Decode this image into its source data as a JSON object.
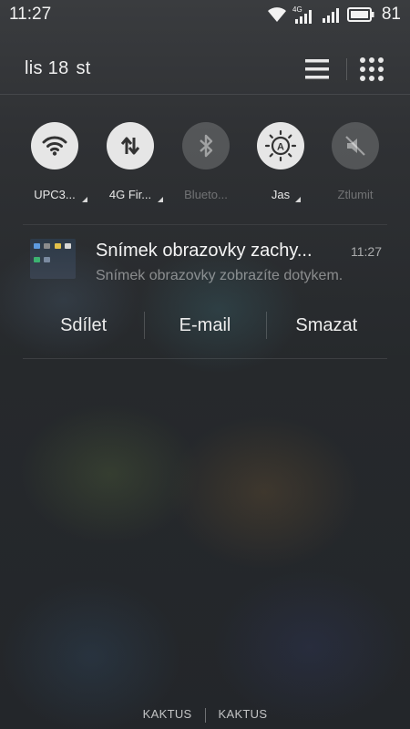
{
  "status_bar": {
    "time": "11:27",
    "network_label": "4G",
    "battery_percent": "81",
    "battery_level": 0.81
  },
  "header": {
    "date": "lis 18",
    "weekday": "st"
  },
  "quick_settings": [
    {
      "label": "UPC3...",
      "icon": "wifi-icon",
      "active": true,
      "expandable": true
    },
    {
      "label": "4G Fir...",
      "icon": "mobile-data-icon",
      "active": true,
      "expandable": true
    },
    {
      "label": "Blueto...",
      "icon": "bluetooth-icon",
      "active": false,
      "expandable": false
    },
    {
      "label": "Jas",
      "icon": "brightness-auto-icon",
      "active": true,
      "expandable": true
    },
    {
      "label": "Ztlumit",
      "icon": "mute-icon",
      "active": false,
      "expandable": false
    }
  ],
  "notification": {
    "title": "Snímek obrazovky zachy...",
    "time": "11:27",
    "body": "Snímek obrazovky zobrazíte dotykem.",
    "actions": [
      "Sdílet",
      "E-mail",
      "Smazat"
    ]
  },
  "carriers": [
    "KAKTUS",
    "KAKTUS"
  ],
  "colors": {
    "toggle_active_bg": "#e6e6e6",
    "toggle_inactive_bg": "rgba(255,255,255,0.18)"
  }
}
